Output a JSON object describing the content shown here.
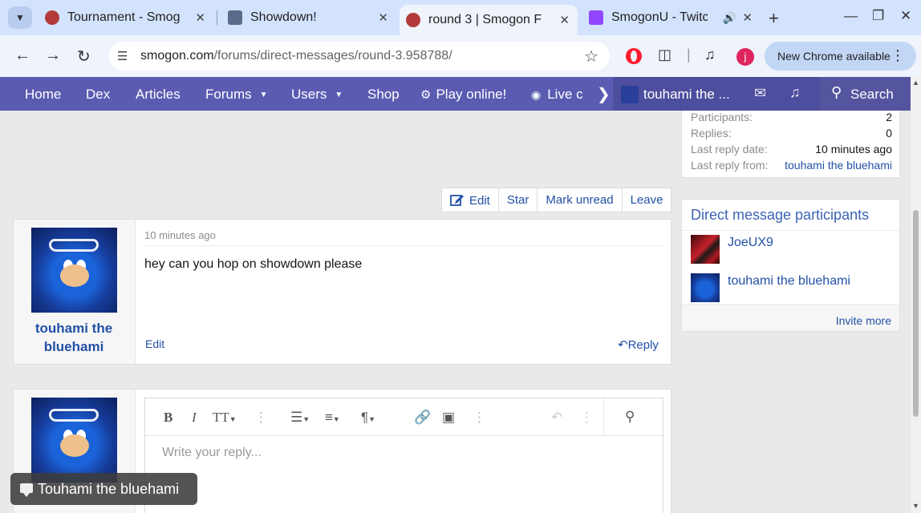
{
  "browser": {
    "tabs": [
      {
        "title": "Tournament - Smog",
        "favicon_color": "#b33a3a",
        "active": false
      },
      {
        "title": "Showdown!",
        "favicon_color": "#5a6a8a",
        "active": false
      },
      {
        "title": "round 3 | Smogon F",
        "favicon_color": "#b33a3a",
        "active": true
      },
      {
        "title": "SmogonU - Twitc",
        "favicon_color": "#9146ff",
        "active": false
      }
    ],
    "url_host": "smogon.com",
    "url_path": "/forums/direct-messages/round-3.958788/",
    "profile_initial": "j",
    "update_label": "New Chrome available",
    "icons": {
      "tab_search": "chevron-down-icon",
      "tab_close": "close-icon",
      "audio": "speaker-icon",
      "new_tab": "plus-icon",
      "back": "back-arrow-icon",
      "forward": "forward-arrow-icon",
      "reload": "reload-icon",
      "site_info": "tune-icon",
      "bookmark": "star-icon",
      "extensions": "puzzle-icon",
      "media": "media-queue-icon",
      "menu": "kebab-icon"
    }
  },
  "sitenav": {
    "items": [
      "Home",
      "Dex",
      "Articles",
      "Forums",
      "Users",
      "Shop",
      "Play online!",
      "Live c"
    ],
    "user": "touhami the ...",
    "search": "Search",
    "colors": {
      "bar": "#5b5bb2",
      "user_area": "#4e4e9e"
    }
  },
  "thread": {
    "actions": {
      "edit": "Edit",
      "star": "Star",
      "mark_unread": "Mark unread",
      "leave": "Leave"
    },
    "message": {
      "username": "touhami the bluehami",
      "time": "10 minutes ago",
      "body": "hey can you hop on showdown please",
      "edit": "Edit",
      "reply": "Reply"
    },
    "editor": {
      "placeholder": "Write your reply..."
    }
  },
  "sidebar": {
    "info": [
      {
        "key": "Participants:",
        "value": "2"
      },
      {
        "key": "Replies:",
        "value": "0"
      },
      {
        "key": "Last reply date:",
        "value": "10 minutes ago"
      },
      {
        "key": "Last reply from:",
        "value": "touhami the bluehami"
      }
    ],
    "participants_title": "Direct message participants",
    "participants": [
      {
        "name": "JoeUX9"
      },
      {
        "name": "touhami the bluehami"
      }
    ],
    "invite_more": "Invite more"
  },
  "caption": "Touhami the bluehami"
}
